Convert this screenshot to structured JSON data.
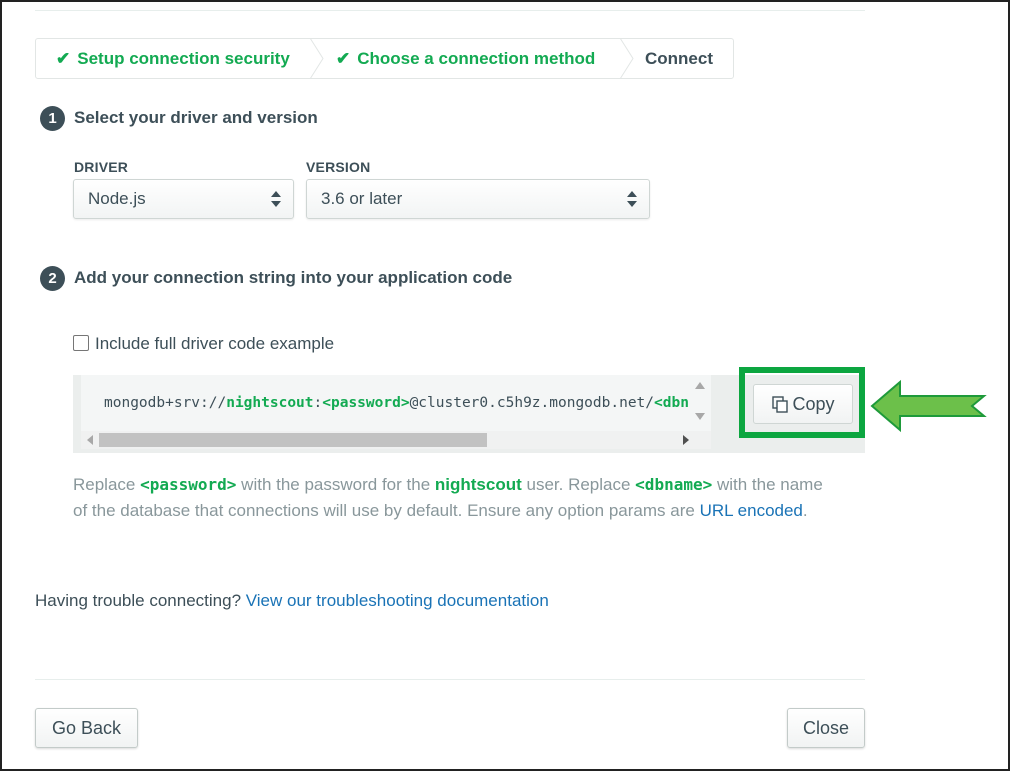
{
  "steps": [
    {
      "label": "Setup connection security",
      "status": "done"
    },
    {
      "label": "Choose a connection method",
      "status": "done"
    },
    {
      "label": "Connect",
      "status": "current"
    }
  ],
  "step1": {
    "number": "1",
    "title": "Select your driver and version",
    "driver_label": "DRIVER",
    "driver_value": "Node.js",
    "version_label": "VERSION",
    "version_value": "3.6 or later"
  },
  "step2": {
    "number": "2",
    "title": "Add your connection string into your application code",
    "checkbox_label": "Include full driver code example",
    "checkbox_checked": false,
    "connection_string": {
      "prefix": "mongodb+srv://",
      "user": "nightscout",
      "sep": ":",
      "password": "<password>",
      "host": "@cluster0.c5h9z.mongodb.net/",
      "dbname": "<dbname>"
    },
    "copy_label": "Copy"
  },
  "help": {
    "t1": "Replace ",
    "password": "<password>",
    "t2": " with the password for the ",
    "user": "nightscout",
    "t3": " user. Replace ",
    "dbname": "<dbname>",
    "t4": " with the name of the database that connections will use by default. Ensure any option params are ",
    "link": "URL encoded",
    "t5": "."
  },
  "trouble": {
    "text": "Having trouble connecting? ",
    "link": "View our troubleshooting documentation"
  },
  "footer": {
    "back_label": "Go Back",
    "close_label": "Close"
  },
  "colors": {
    "accent_green": "#13aa52",
    "highlight_green": "#0ca640",
    "arrow_green": "#6cc04a",
    "link_blue": "#1a73b6"
  }
}
